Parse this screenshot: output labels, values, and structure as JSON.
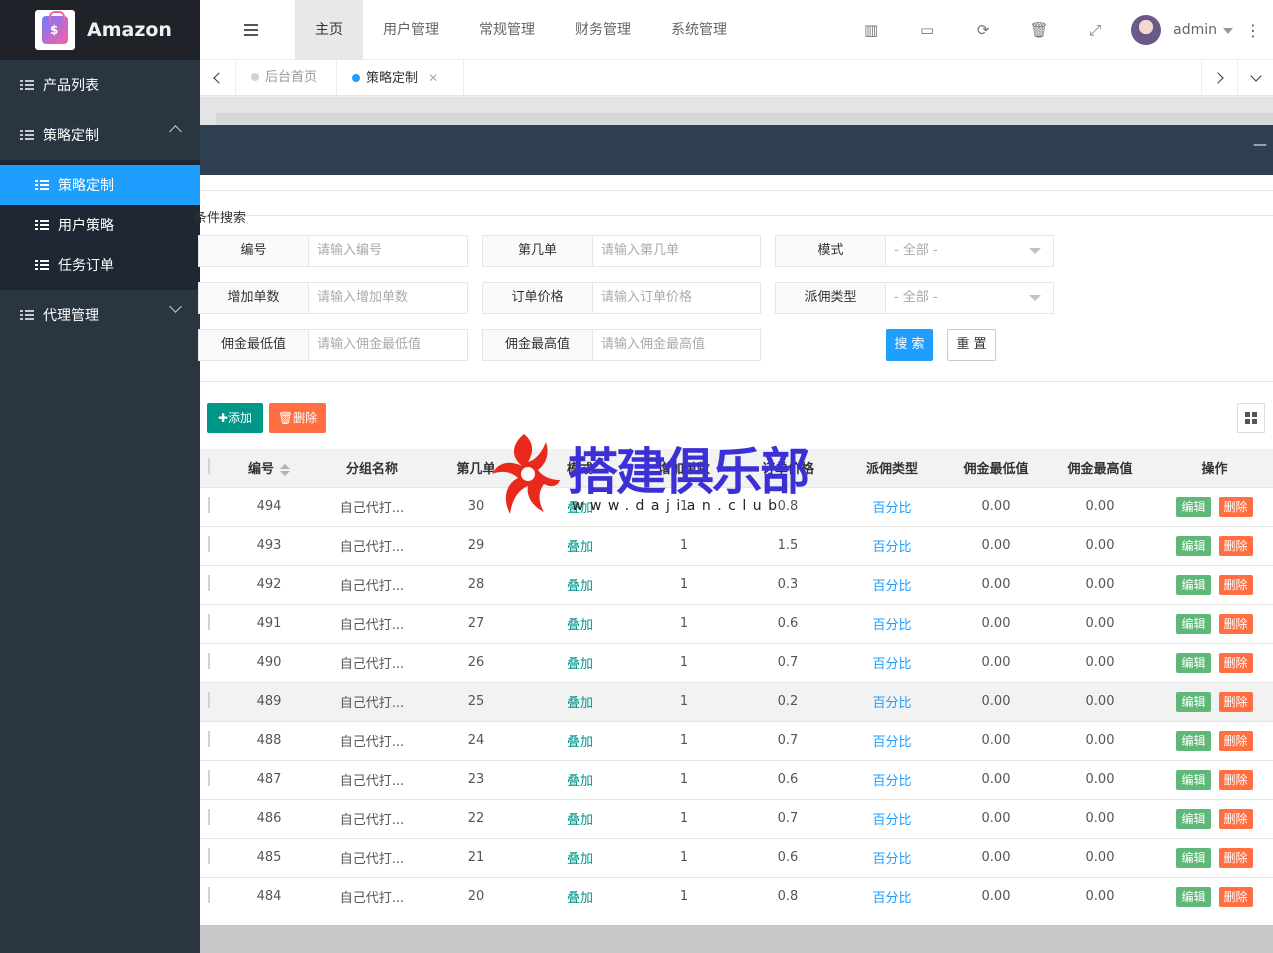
{
  "brand": {
    "name": "Amazon"
  },
  "sidebar": {
    "items": [
      {
        "label": "产品列表"
      },
      {
        "label": "策略定制",
        "children": [
          {
            "label": "策略定制"
          },
          {
            "label": "用户策略"
          },
          {
            "label": "任务订单"
          }
        ]
      },
      {
        "label": "代理管理"
      }
    ]
  },
  "header": {
    "menu": [
      "主页",
      "用户管理",
      "常规管理",
      "财务管理",
      "系统管理"
    ],
    "user": "admin"
  },
  "tabs": [
    {
      "label": "后台首页"
    },
    {
      "label": "策略定制"
    }
  ],
  "panel": {
    "minimize": "—"
  },
  "search": {
    "legend": "条件搜索",
    "fields": [
      {
        "label": "编号",
        "placeholder": "请输入编号"
      },
      {
        "label": "第几单",
        "placeholder": "请输入第几单"
      },
      {
        "label": "模式",
        "value": "- 全部 -"
      },
      {
        "label": "增加单数",
        "placeholder": "请输入增加单数"
      },
      {
        "label": "订单价格",
        "placeholder": "请输入订单价格"
      },
      {
        "label": "派佣类型",
        "value": "- 全部 -"
      },
      {
        "label": "佣金最低值",
        "placeholder": "请输入佣金最低值"
      },
      {
        "label": "佣金最高值",
        "placeholder": "请输入佣金最高值"
      }
    ],
    "search_label": "搜 索",
    "reset_label": "重 置"
  },
  "toolbar": {
    "add_label": "✚添加",
    "delete_label": "🗑删除"
  },
  "table": {
    "headers": [
      "编号",
      "分组名称",
      "第几单",
      "模式",
      "增加单数",
      "订单价格",
      "派佣类型",
      "佣金最低值",
      "佣金最高值",
      "操作"
    ],
    "rows": [
      {
        "id": "494",
        "group": "自己代打...",
        "nth": "30",
        "mode": "叠加",
        "add": "1",
        "price": "0.8",
        "ptype": "百分比",
        "min": "0.00",
        "max": "0.00"
      },
      {
        "id": "493",
        "group": "自己代打...",
        "nth": "29",
        "mode": "叠加",
        "add": "1",
        "price": "1.5",
        "ptype": "百分比",
        "min": "0.00",
        "max": "0.00"
      },
      {
        "id": "492",
        "group": "自己代打...",
        "nth": "28",
        "mode": "叠加",
        "add": "1",
        "price": "0.3",
        "ptype": "百分比",
        "min": "0.00",
        "max": "0.00"
      },
      {
        "id": "491",
        "group": "自己代打...",
        "nth": "27",
        "mode": "叠加",
        "add": "1",
        "price": "0.6",
        "ptype": "百分比",
        "min": "0.00",
        "max": "0.00"
      },
      {
        "id": "490",
        "group": "自己代打...",
        "nth": "26",
        "mode": "叠加",
        "add": "1",
        "price": "0.7",
        "ptype": "百分比",
        "min": "0.00",
        "max": "0.00"
      },
      {
        "id": "489",
        "group": "自己代打...",
        "nth": "25",
        "mode": "叠加",
        "add": "1",
        "price": "0.2",
        "ptype": "百分比",
        "min": "0.00",
        "max": "0.00"
      },
      {
        "id": "488",
        "group": "自己代打...",
        "nth": "24",
        "mode": "叠加",
        "add": "1",
        "price": "0.7",
        "ptype": "百分比",
        "min": "0.00",
        "max": "0.00"
      },
      {
        "id": "487",
        "group": "自己代打...",
        "nth": "23",
        "mode": "叠加",
        "add": "1",
        "price": "0.6",
        "ptype": "百分比",
        "min": "0.00",
        "max": "0.00"
      },
      {
        "id": "486",
        "group": "自己代打...",
        "nth": "22",
        "mode": "叠加",
        "add": "1",
        "price": "0.7",
        "ptype": "百分比",
        "min": "0.00",
        "max": "0.00"
      },
      {
        "id": "485",
        "group": "自己代打...",
        "nth": "21",
        "mode": "叠加",
        "add": "1",
        "price": "0.6",
        "ptype": "百分比",
        "min": "0.00",
        "max": "0.00"
      },
      {
        "id": "484",
        "group": "自己代打...",
        "nth": "20",
        "mode": "叠加",
        "add": "1",
        "price": "0.8",
        "ptype": "百分比",
        "min": "0.00",
        "max": "0.00"
      }
    ],
    "edit_label": "编辑",
    "delete_label": "删除"
  },
  "watermark": {
    "text": "搭建俱乐部",
    "url": "www.dajian.club"
  },
  "colors": {
    "primary": "#1e9fff",
    "sidebar": "#2a3542",
    "panel_head": "#2f3f52",
    "teal": "#009688",
    "danger": "#ff5722",
    "edit": "#5fb878"
  },
  "icons": [
    "hamburger-icon",
    "bar-chart-icon",
    "card-icon",
    "refresh-icon",
    "trash-icon",
    "fullscreen-icon",
    "more-icon",
    "grid-icon"
  ]
}
